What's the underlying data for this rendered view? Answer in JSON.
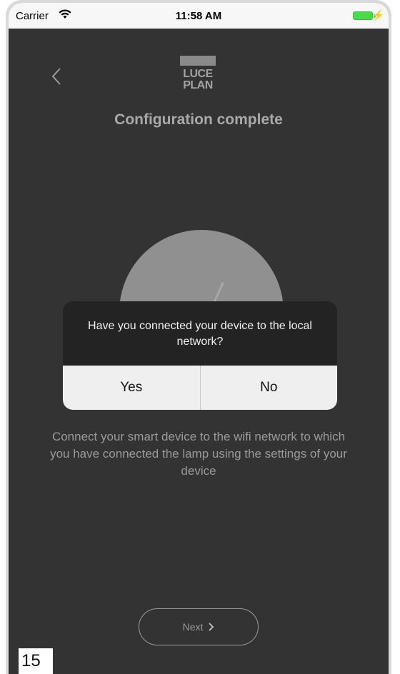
{
  "status_bar": {
    "carrier": "Carrier",
    "time": "11:58 AM",
    "battery_color": "#4cd94c"
  },
  "header": {
    "back_icon": "chevron-left-icon",
    "logo_line1": "LUCE",
    "logo_line2": "PLAN",
    "title": "Configuration complete"
  },
  "dialog": {
    "message": "Have you connected your device to the local network?",
    "yes_label": "Yes",
    "no_label": "No"
  },
  "instructions": "Connect your smart device to the wifi network to which you have connected the lamp using the settings of your device",
  "footer": {
    "next_label": "Next",
    "next_icon": "chevron-right-icon"
  },
  "page_number": "15",
  "colors": {
    "background": "#333333",
    "dialog_bg": "#232323",
    "button_bg": "#efefef"
  }
}
